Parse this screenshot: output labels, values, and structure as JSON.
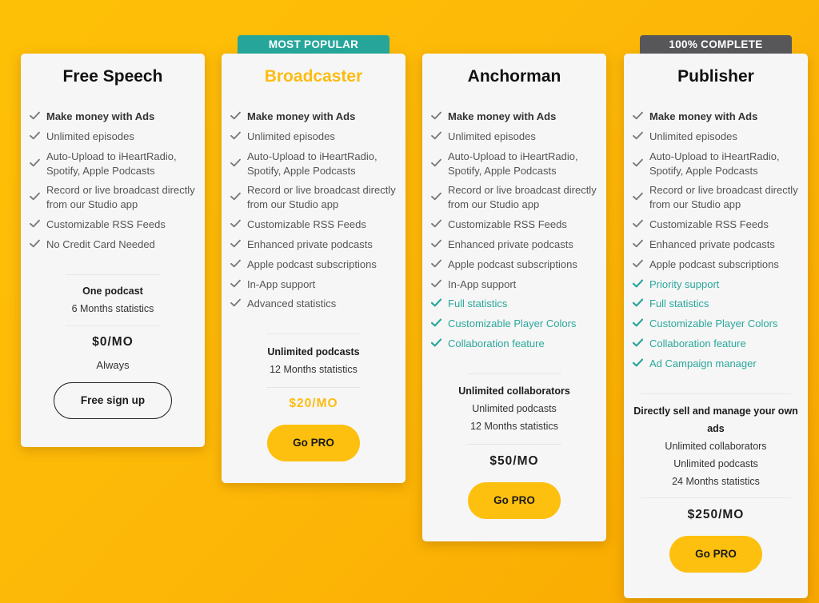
{
  "colors": {
    "background": "#fdb807",
    "accent_yellow": "#fcbc12",
    "teal": "#26a69a",
    "ribbon_gray": "#57575a",
    "card": "#f6f6f6"
  },
  "plans": [
    {
      "name": "Free Speech",
      "ribbon": null,
      "features": [
        {
          "text": "Make money with Ads",
          "style": "bold"
        },
        {
          "text": "Unlimited episodes",
          "style": "normal"
        },
        {
          "text": "Auto-Upload to iHeartRadio, Spotify, Apple Podcasts",
          "style": "normal"
        },
        {
          "text": "Record or live broadcast directly from our Studio app",
          "style": "normal"
        },
        {
          "text": "Customizable RSS Feeds",
          "style": "normal"
        },
        {
          "text": "No Credit Card Needed",
          "style": "normal"
        }
      ],
      "summary_main": "One podcast",
      "summary_sub": [
        "6 Months statistics"
      ],
      "price": "$0/MO",
      "price_note": "Always",
      "button": "Free sign up"
    },
    {
      "name": "Broadcaster",
      "ribbon": "MOST POPULAR",
      "features": [
        {
          "text": "Make money with Ads",
          "style": "bold"
        },
        {
          "text": "Unlimited episodes",
          "style": "normal"
        },
        {
          "text": "Auto-Upload to iHeartRadio, Spotify, Apple Podcasts",
          "style": "normal"
        },
        {
          "text": "Record or live broadcast directly from our Studio app",
          "style": "normal"
        },
        {
          "text": "Customizable RSS Feeds",
          "style": "normal"
        },
        {
          "text": "Enhanced private podcasts",
          "style": "normal"
        },
        {
          "text": "Apple podcast subscriptions",
          "style": "normal"
        },
        {
          "text": "In-App support",
          "style": "normal"
        },
        {
          "text": "Advanced statistics",
          "style": "normal"
        }
      ],
      "summary_main": "Unlimited podcasts",
      "summary_sub": [
        "12 Months statistics"
      ],
      "price": "$20/MO",
      "button": "Go PRO"
    },
    {
      "name": "Anchorman",
      "ribbon": null,
      "features": [
        {
          "text": "Make money with Ads",
          "style": "bold"
        },
        {
          "text": "Unlimited episodes",
          "style": "normal"
        },
        {
          "text": "Auto-Upload to iHeartRadio, Spotify, Apple Podcasts",
          "style": "normal"
        },
        {
          "text": "Record or live broadcast directly from our Studio app",
          "style": "normal"
        },
        {
          "text": "Customizable RSS Feeds",
          "style": "normal"
        },
        {
          "text": "Enhanced private podcasts",
          "style": "normal"
        },
        {
          "text": "Apple podcast subscriptions",
          "style": "normal"
        },
        {
          "text": "In-App support",
          "style": "normal"
        },
        {
          "text": "Full statistics",
          "style": "teal"
        },
        {
          "text": "Customizable Player Colors",
          "style": "teal"
        },
        {
          "text": "Collaboration feature",
          "style": "teal"
        }
      ],
      "summary_main": "Unlimited collaborators",
      "summary_sub": [
        "Unlimited podcasts",
        "12 Months statistics"
      ],
      "price": "$50/MO",
      "button": "Go PRO"
    },
    {
      "name": "Publisher",
      "ribbon": "100% COMPLETE",
      "features": [
        {
          "text": "Make money with Ads",
          "style": "bold"
        },
        {
          "text": "Unlimited episodes",
          "style": "normal"
        },
        {
          "text": "Auto-Upload to iHeartRadio, Spotify, Apple Podcasts",
          "style": "normal"
        },
        {
          "text": "Record or live broadcast directly from our Studio app",
          "style": "normal"
        },
        {
          "text": "Customizable RSS Feeds",
          "style": "normal"
        },
        {
          "text": "Enhanced private podcasts",
          "style": "normal"
        },
        {
          "text": "Apple podcast subscriptions",
          "style": "normal"
        },
        {
          "text": "Priority support",
          "style": "teal"
        },
        {
          "text": "Full statistics",
          "style": "teal"
        },
        {
          "text": "Customizable Player Colors",
          "style": "teal"
        },
        {
          "text": "Collaboration feature",
          "style": "teal"
        },
        {
          "text": "Ad Campaign manager",
          "style": "teal"
        }
      ],
      "summary_main": "Directly sell and manage your own ads",
      "summary_sub": [
        "Unlimited collaborators",
        "Unlimited podcasts",
        "24 Months statistics"
      ],
      "price": "$250/MO",
      "button": "Go PRO"
    }
  ]
}
